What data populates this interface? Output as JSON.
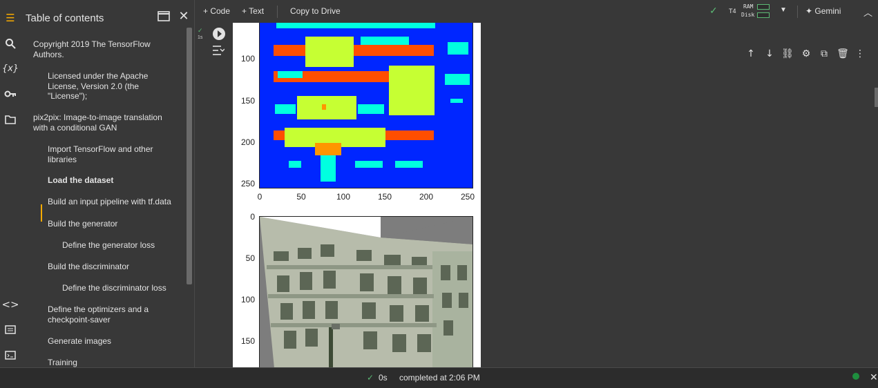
{
  "toolbar": {
    "code_label": "+ Code",
    "text_label": "+ Text",
    "drive_label": "Copy to Drive",
    "runtime_type": "T4",
    "ram_label": "RAM",
    "disk_label": "Disk",
    "gemini_label": "✦ Gemini"
  },
  "toc": {
    "title": "Table of contents",
    "items": [
      {
        "label": "Copyright 2019 The TensorFlow Authors."
      },
      {
        "label": "Licensed under the Apache License, Version 2.0 (the \"License\");"
      },
      {
        "label": "pix2pix: Image-to-image translation with a conditional GAN"
      },
      {
        "label": "Import TensorFlow and other libraries"
      },
      {
        "label": "Load the dataset"
      },
      {
        "label": "Build an input pipeline with tf.data"
      },
      {
        "label": "Build the generator"
      },
      {
        "label": "Define the generator loss"
      },
      {
        "label": "Build the discriminator"
      },
      {
        "label": "Define the discriminator loss"
      },
      {
        "label": "Define the optimizers and a checkpoint-saver"
      },
      {
        "label": "Generate images"
      },
      {
        "label": "Training"
      }
    ]
  },
  "cell": {
    "exec_time": "1s"
  },
  "plot1": {
    "yticks": [
      "100",
      "150",
      "200",
      "250"
    ],
    "xticks": [
      "0",
      "50",
      "100",
      "150",
      "200",
      "250"
    ]
  },
  "plot2": {
    "yticks": [
      "0",
      "50",
      "100",
      "150"
    ]
  },
  "status": {
    "elapsed": "0s",
    "message": "completed at 2:06 PM"
  },
  "colors": {
    "accent_active": "#f9ab00",
    "status_ok": "#1e8e3e",
    "check": "#5bb974"
  }
}
